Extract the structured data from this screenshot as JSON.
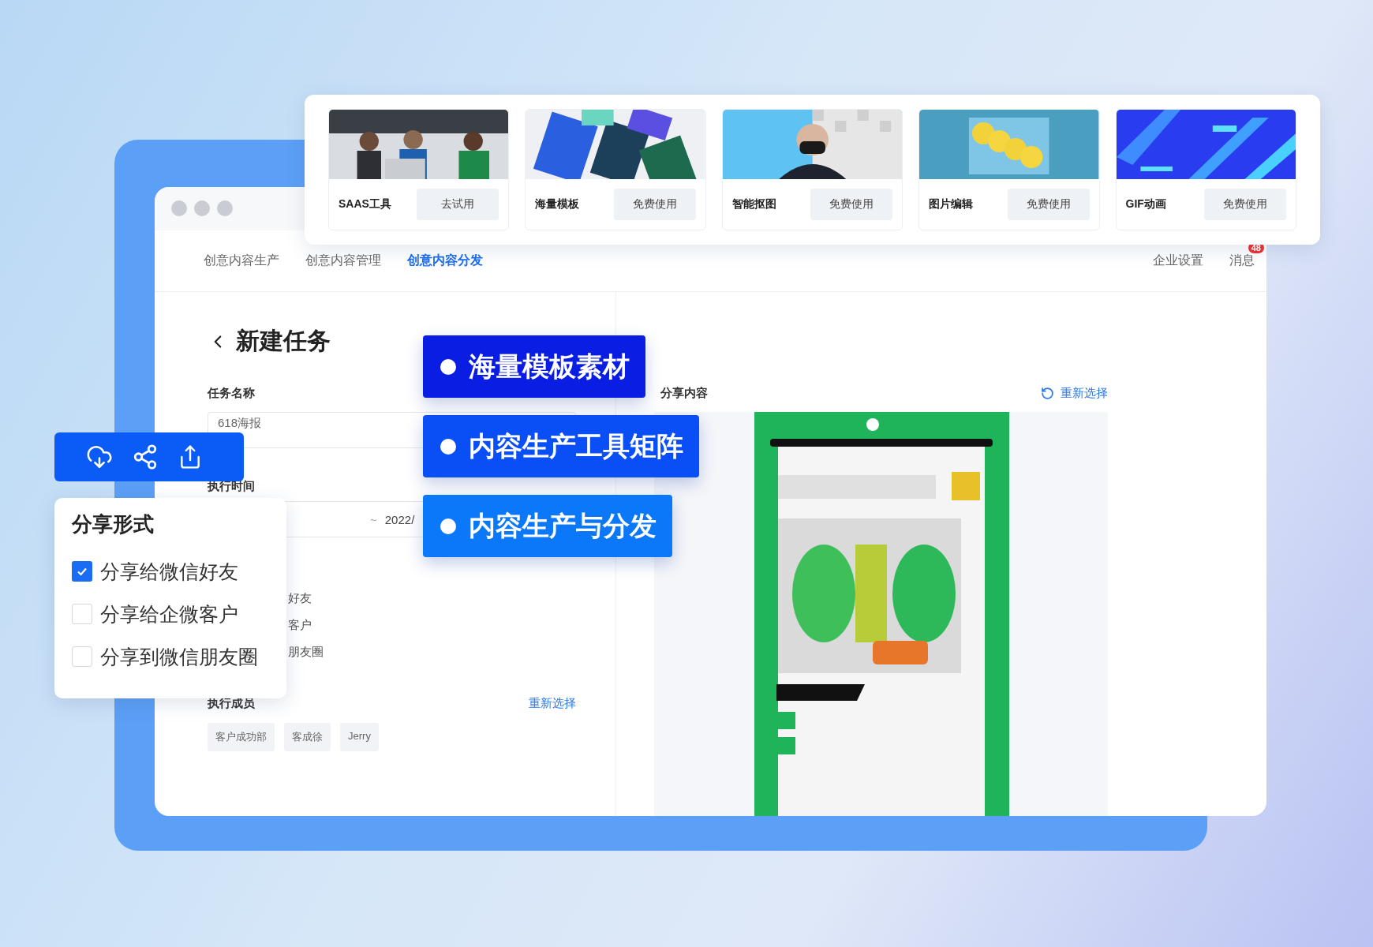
{
  "tools": [
    {
      "name": "SAAS工具",
      "button": "去试用"
    },
    {
      "name": "海量模板",
      "button": "免费使用"
    },
    {
      "name": "智能抠图",
      "button": "免费使用"
    },
    {
      "name": "图片编辑",
      "button": "免费使用"
    },
    {
      "name": "GIF动画",
      "button": "免费使用"
    }
  ],
  "window": {
    "nav": [
      {
        "label": "创意内容生产",
        "selected": false
      },
      {
        "label": "创意内容管理",
        "selected": false
      },
      {
        "label": "创意内容分发",
        "selected": true
      }
    ],
    "nav_right": [
      {
        "label": "企业设置"
      },
      {
        "label": "消息",
        "badge": "48"
      }
    ]
  },
  "form": {
    "title": "新建任务",
    "task_name": {
      "label": "任务名称",
      "value": "618海报"
    },
    "exec_time": {
      "label": "执行时间",
      "separator": "~",
      "end": "2022/"
    },
    "share_options": [
      "好友",
      "客户",
      "朋友圈"
    ],
    "members": {
      "label": "执行成员",
      "action": "重新选择",
      "tags": [
        "客户成功部",
        "客成徐",
        "Jerry"
      ]
    }
  },
  "preview": {
    "label": "分享内容",
    "action": "重新选择"
  },
  "highlights": [
    "海量模板素材",
    "内容生产工具矩阵",
    "内容生产与分发"
  ],
  "share_popup": {
    "title": "分享形式",
    "options": [
      {
        "label": "分享给微信好友",
        "checked": true
      },
      {
        "label": "分享给企微客户",
        "checked": false
      },
      {
        "label": "分享到微信朋友圈",
        "checked": false
      }
    ]
  }
}
